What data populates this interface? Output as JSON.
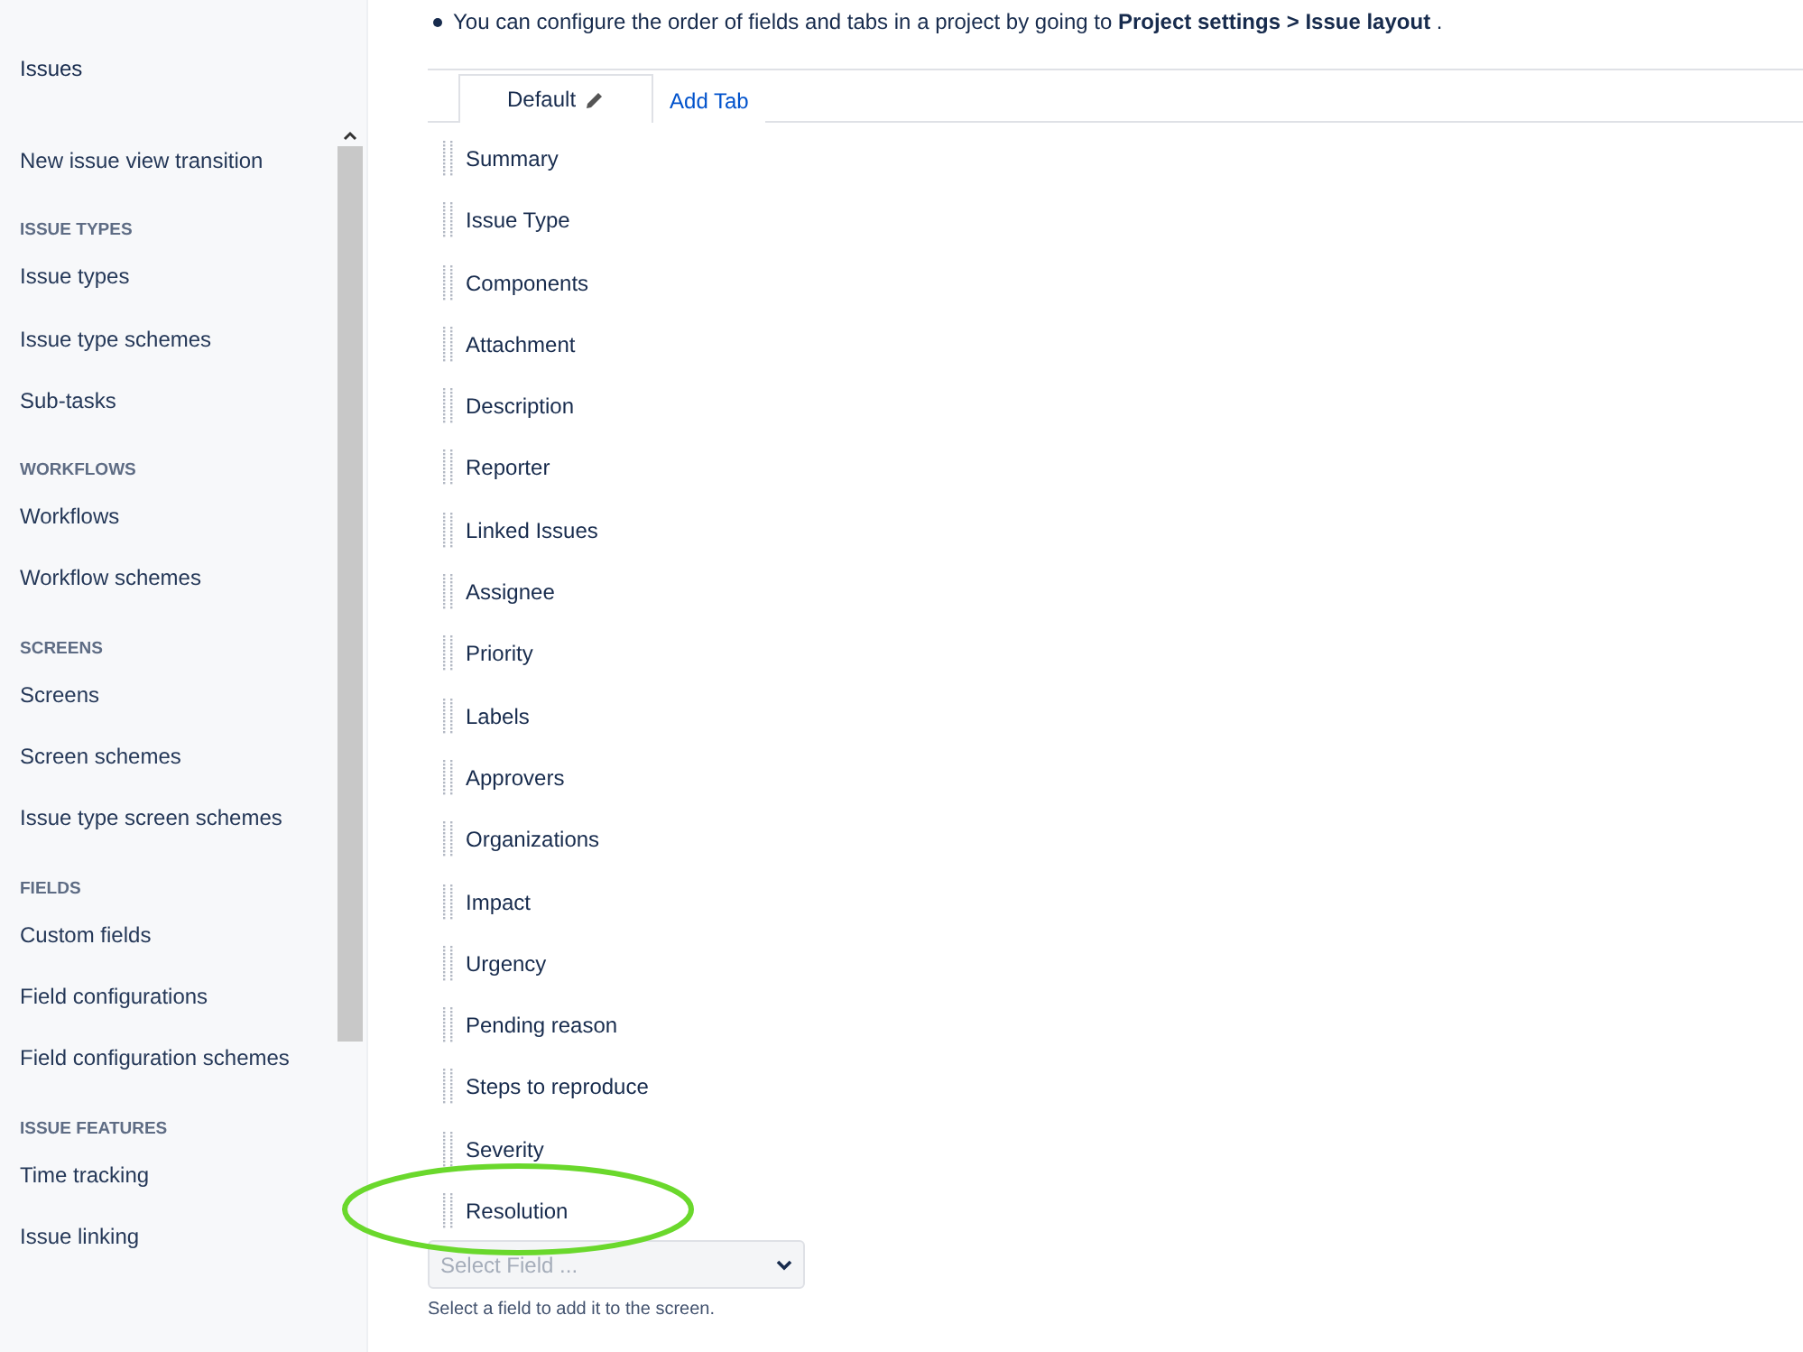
{
  "sidebar": {
    "title": "Issues",
    "items": [
      {
        "kind": "link",
        "label": "New issue view transition"
      },
      {
        "kind": "heading",
        "label": "ISSUE TYPES"
      },
      {
        "kind": "link",
        "label": "Issue types"
      },
      {
        "kind": "link",
        "label": "Issue type schemes"
      },
      {
        "kind": "link",
        "label": "Sub-tasks"
      },
      {
        "kind": "heading",
        "label": "WORKFLOWS"
      },
      {
        "kind": "link",
        "label": "Workflows"
      },
      {
        "kind": "link",
        "label": "Workflow schemes"
      },
      {
        "kind": "heading",
        "label": "SCREENS"
      },
      {
        "kind": "link",
        "label": "Screens"
      },
      {
        "kind": "link",
        "label": "Screen schemes"
      },
      {
        "kind": "link",
        "label": "Issue type screen schemes"
      },
      {
        "kind": "heading",
        "label": "FIELDS"
      },
      {
        "kind": "link",
        "label": "Custom fields"
      },
      {
        "kind": "link",
        "label": "Field configurations"
      },
      {
        "kind": "link",
        "label": "Field configuration schemes"
      },
      {
        "kind": "heading",
        "label": "ISSUE FEATURES"
      },
      {
        "kind": "link",
        "label": "Time tracking"
      },
      {
        "kind": "link",
        "label": "Issue linking"
      }
    ]
  },
  "notice": "You can configure the order of fields and tabs in a project by going to **Project settings** **>** **Issue layout** .",
  "tabs": [
    {
      "label": "Default",
      "selected": true,
      "editable": true
    },
    {
      "label": "Add Tab",
      "selected": false,
      "editable": false
    }
  ],
  "fields": [
    {
      "label": "Summary",
      "highlighted": false
    },
    {
      "label": "Issue Type",
      "highlighted": false
    },
    {
      "label": "Components",
      "highlighted": false
    },
    {
      "label": "Attachment",
      "highlighted": false
    },
    {
      "label": "Description",
      "highlighted": false
    },
    {
      "label": "Reporter",
      "highlighted": false
    },
    {
      "label": "Linked Issues",
      "highlighted": false
    },
    {
      "label": "Assignee",
      "highlighted": false
    },
    {
      "label": "Priority",
      "highlighted": false
    },
    {
      "label": "Labels",
      "highlighted": false
    },
    {
      "label": "Approvers",
      "highlighted": false
    },
    {
      "label": "Organizations",
      "highlighted": false
    },
    {
      "label": "Impact",
      "highlighted": false
    },
    {
      "label": "Urgency",
      "highlighted": false
    },
    {
      "label": "Pending reason",
      "highlighted": false
    },
    {
      "label": "Steps to reproduce",
      "highlighted": false
    },
    {
      "label": "Severity",
      "highlighted": false
    },
    {
      "label": "Resolution",
      "highlighted": true
    }
  ],
  "add_field": {
    "placeholder": "Select Field ...",
    "help": "Select a field to add it to the screen."
  }
}
